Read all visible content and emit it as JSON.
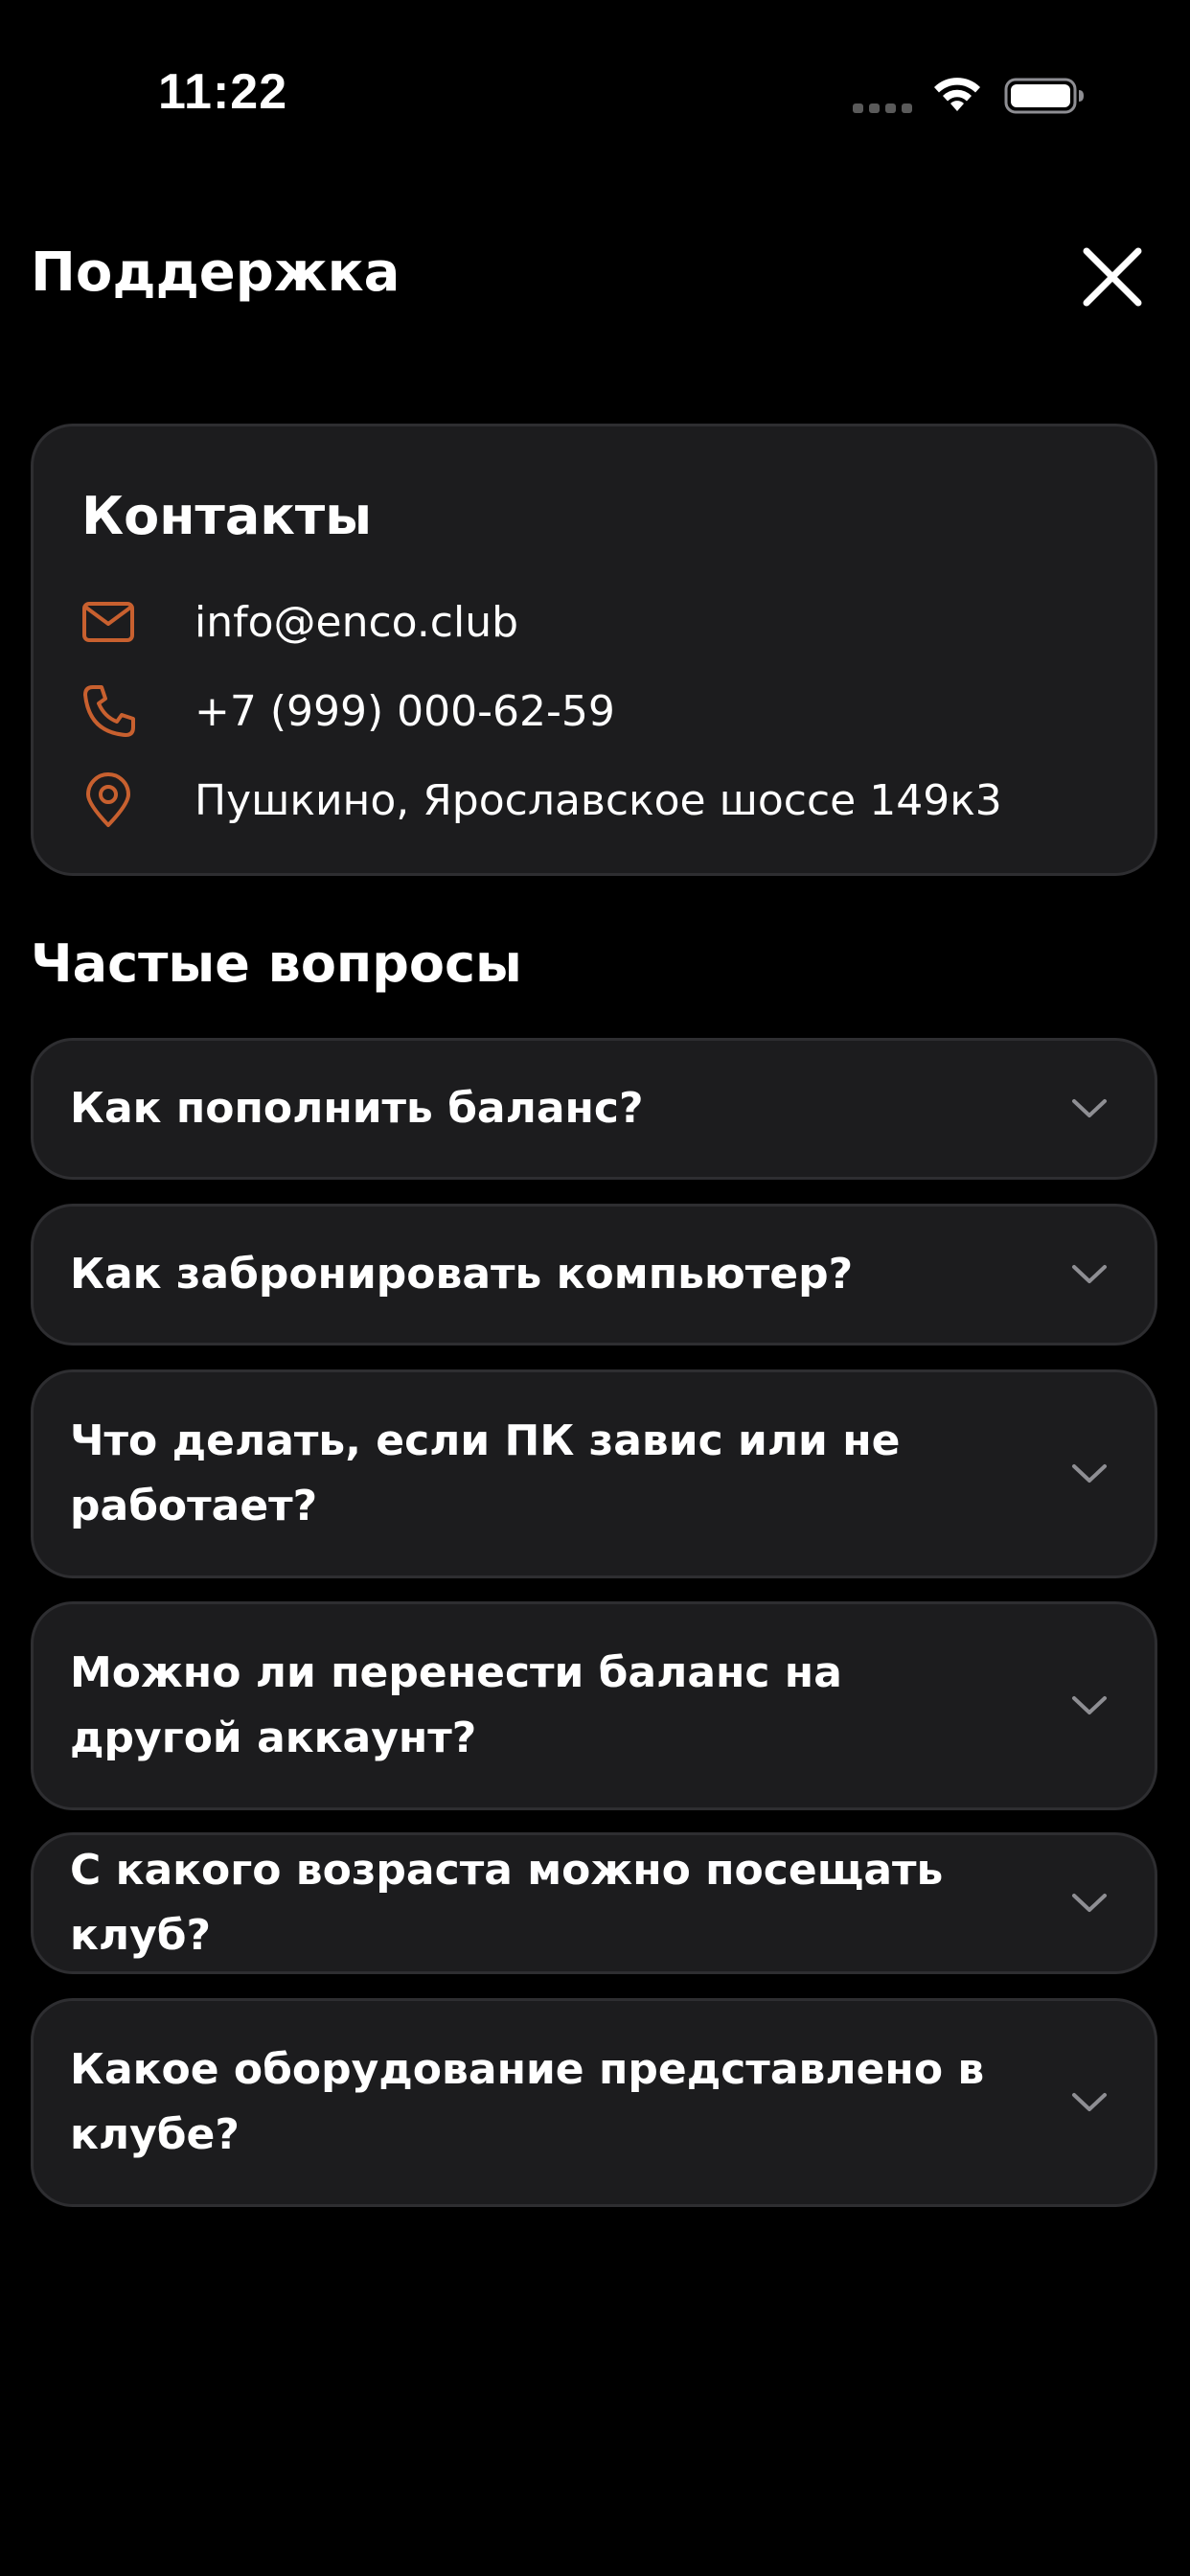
{
  "status_bar": {
    "time": "11:22",
    "wifi_icon": "wifi-icon",
    "battery_icon": "battery-icon",
    "signal_icon": "cellular-signal-icon"
  },
  "header": {
    "title": "Поддержка",
    "close_icon": "close-icon"
  },
  "contacts": {
    "title": "Контакты",
    "accent_color": "#c8602f",
    "items": [
      {
        "icon": "mail-icon",
        "text": "info@enco.club"
      },
      {
        "icon": "phone-icon",
        "text": "+7 (999) 000-62-59"
      },
      {
        "icon": "location-pin-icon",
        "text": "Пушкино, Ярославское шоссе 149к3"
      }
    ]
  },
  "faq": {
    "title": "Частые вопросы",
    "items": [
      {
        "question": "Как пополнить баланс?",
        "expanded": false
      },
      {
        "question": "Как забронировать компьютер?",
        "expanded": false
      },
      {
        "question": "Что делать, если ПК завис или не работает?",
        "expanded": false
      },
      {
        "question": "Можно ли перенести баланс на другой аккаунт?",
        "expanded": false
      },
      {
        "question": "С какого возраста можно посещать клуб?",
        "expanded": false
      },
      {
        "question": "Какое оборудование представлено в клубе?",
        "expanded": false
      }
    ]
  },
  "colors": {
    "background": "#000000",
    "card": "#1c1c1e",
    "card_border": "#2e2e31",
    "text": "#ffffff",
    "chevron": "#8e8e93",
    "accent": "#c8602f"
  }
}
